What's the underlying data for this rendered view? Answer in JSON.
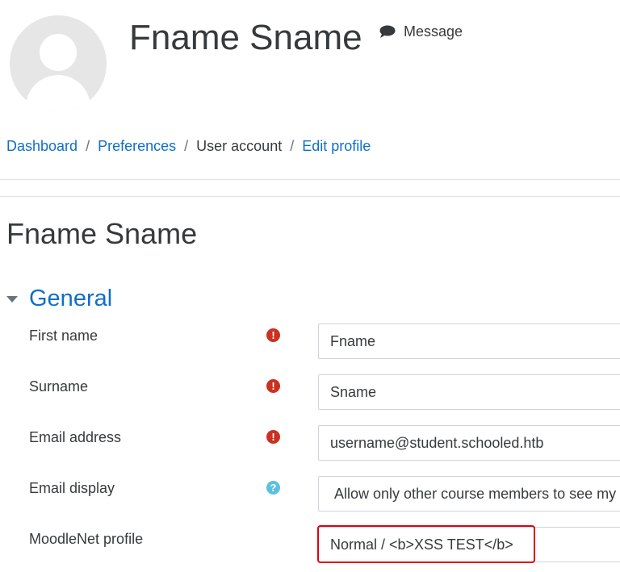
{
  "header": {
    "user_name": "Fname Sname",
    "message_label": "Message"
  },
  "breadcrumb": [
    {
      "label": "Dashboard",
      "link": true
    },
    {
      "label": "Preferences",
      "link": true
    },
    {
      "label": "User account",
      "link": false
    },
    {
      "label": "Edit profile",
      "link": true
    }
  ],
  "breadcrumb_separator": "/",
  "page_title": "Fname Sname",
  "section": {
    "title": "General"
  },
  "fields": {
    "first_name": {
      "label": "First name",
      "value": "Fname",
      "icon": "required-icon"
    },
    "surname": {
      "label": "Surname",
      "value": "Sname",
      "icon": "required-icon"
    },
    "email": {
      "label": "Email address",
      "value": "username@student.schooled.htb",
      "icon": "required-icon"
    },
    "email_display": {
      "label": "Email display",
      "value": "Allow only other course members to see my email address",
      "icon": "help-icon"
    },
    "moodlenet": {
      "label": "MoodleNet profile",
      "value": "Normal / <b>XSS TEST</b>"
    }
  },
  "colors": {
    "link": "#0f6fc5",
    "required": "#ca3120",
    "help": "#5bc0de",
    "highlight": "#e3000f"
  }
}
